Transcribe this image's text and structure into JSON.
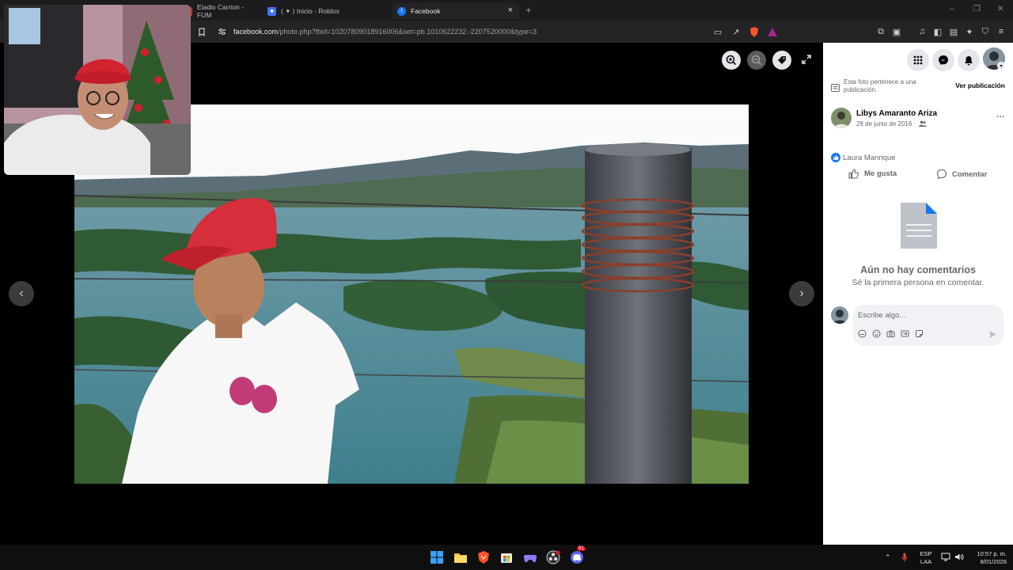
{
  "browser": {
    "tabs": [
      {
        "label": "Eladio Carrion - FUM",
        "active": false
      },
      {
        "label": "( ✦ ) Inicio - Roblox",
        "active": false
      },
      {
        "label": "Facebook",
        "active": true
      }
    ],
    "tab_close": "×",
    "new_tab": "+",
    "url_domain": "facebook.com",
    "url_path": "/photo.php?fbid=10207809018916006&set=pb.1010622232.-2207520000&type=3",
    "window_controls": [
      "–",
      "❒",
      "✕"
    ]
  },
  "viewer": {
    "prev": "‹",
    "next": "›"
  },
  "side": {
    "notice": "Esta foto pertenece a una publicación.",
    "notice_link": "Ver publicación",
    "author": "Libys Amaranto Ariza",
    "date": "28 de junio de 2016 ·",
    "more": "···",
    "reactor": "Laura Manrique",
    "like": "Me gusta",
    "comment": "Comentar",
    "empty_title": "Aún no hay comentarios",
    "empty_sub": "Sé la primera persona en comentar.",
    "comment_placeholder": "Escribe algo..."
  },
  "taskbar": {
    "lang_top": "ESP",
    "lang_bottom": "LAA",
    "time": "10:57 p. m.",
    "date": "8/01/2026",
    "discord_badge": "91"
  },
  "colors": {
    "facebook_blue": "#1877f2",
    "panel_bg": "#ffffff",
    "chrome_bg": "#242426"
  }
}
